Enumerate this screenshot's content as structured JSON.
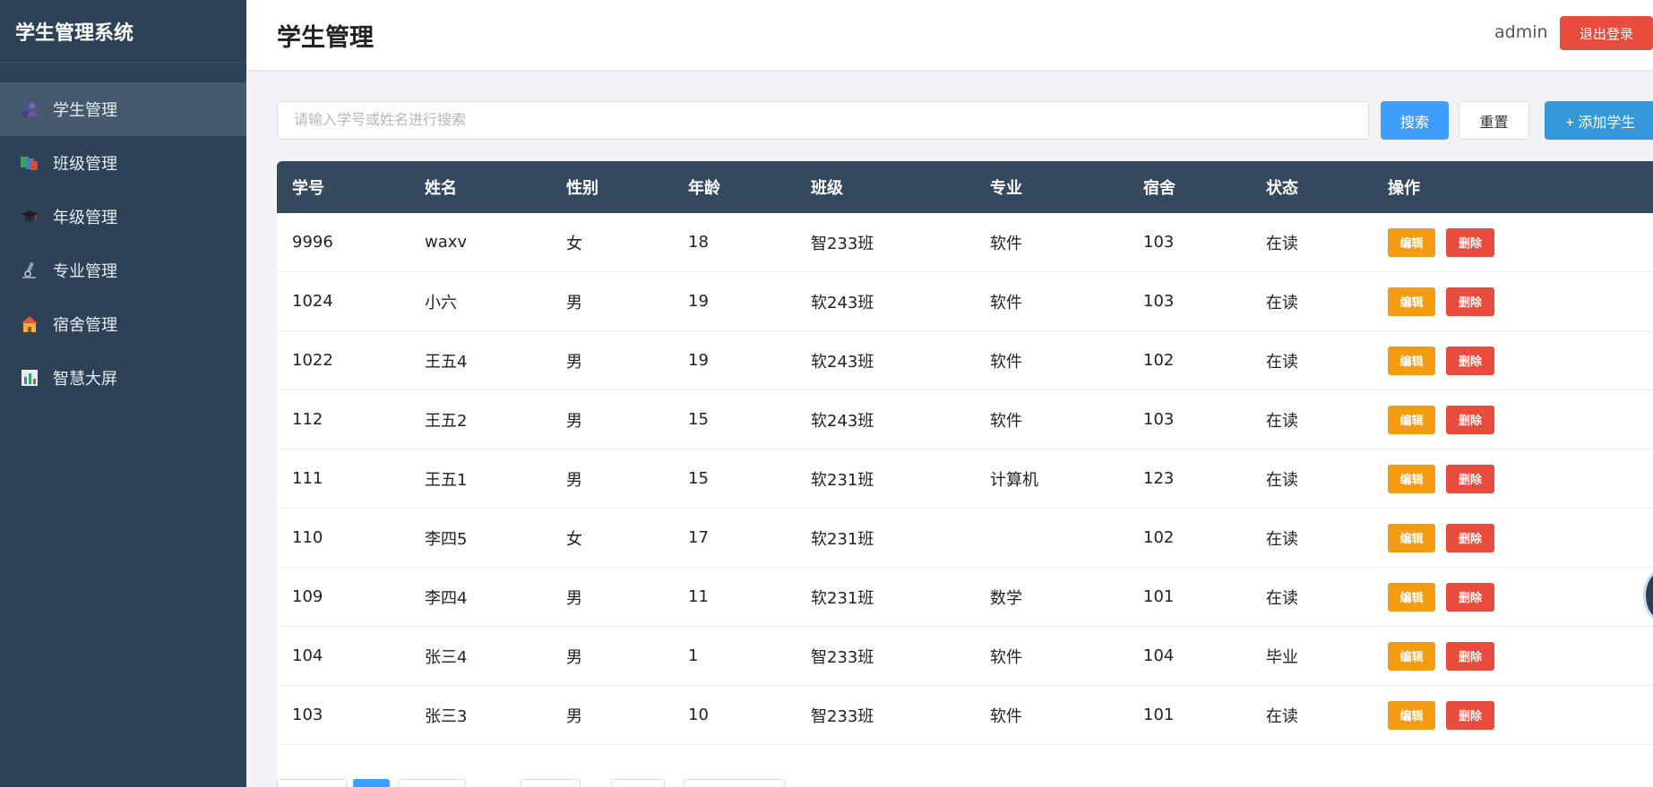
{
  "sidebar": {
    "brand": "学生管理系统",
    "items": [
      {
        "label": "学生管理",
        "icon": "students-icon",
        "active": true
      },
      {
        "label": "班级管理",
        "icon": "class-icon",
        "active": false
      },
      {
        "label": "年级管理",
        "icon": "grade-icon",
        "active": false
      },
      {
        "label": "专业管理",
        "icon": "major-icon",
        "active": false
      },
      {
        "label": "宿舍管理",
        "icon": "dorm-icon",
        "active": false
      },
      {
        "label": "智慧大屏",
        "icon": "dashboard-icon",
        "active": false
      }
    ]
  },
  "header": {
    "title": "学生管理",
    "username": "admin",
    "logout_label": "退出登录"
  },
  "search": {
    "placeholder": "请输入学号或姓名进行搜索",
    "value": "",
    "search_label": "搜索",
    "reset_label": "重置",
    "add_label": "+ 添加学生"
  },
  "table": {
    "columns": [
      "学号",
      "姓名",
      "性别",
      "年龄",
      "班级",
      "专业",
      "宿舍",
      "状态",
      "操作"
    ],
    "edit_label": "编辑",
    "delete_label": "删除",
    "rows": [
      [
        "9996",
        "waxv",
        "女",
        "18",
        "智233班",
        "软件",
        "103",
        "在读"
      ],
      [
        "1024",
        "小六",
        "男",
        "19",
        "软243班",
        "软件",
        "103",
        "在读"
      ],
      [
        "1022",
        "王五4",
        "男",
        "19",
        "软243班",
        "软件",
        "102",
        "在读"
      ],
      [
        "112",
        "王五2",
        "男",
        "15",
        "软243班",
        "软件",
        "103",
        "在读"
      ],
      [
        "111",
        "王五1",
        "男",
        "15",
        "软231班",
        "计算机",
        "123",
        "在读"
      ],
      [
        "110",
        "李四5",
        "女",
        "17",
        "软231班",
        "",
        "102",
        "在读"
      ],
      [
        "109",
        "李四4",
        "男",
        "11",
        "软231班",
        "数学",
        "101",
        "在读"
      ],
      [
        "104",
        "张三4",
        "男",
        "1",
        "智233班",
        "软件",
        "104",
        "毕业"
      ],
      [
        "103",
        "张三3",
        "男",
        "10",
        "智233班",
        "软件",
        "101",
        "在读"
      ]
    ]
  },
  "colors": {
    "sidebar_bg": "#2e4257",
    "table_header_bg": "#34495e",
    "primary": "#409eff",
    "danger": "#e74c3c",
    "warning": "#f39c12"
  }
}
